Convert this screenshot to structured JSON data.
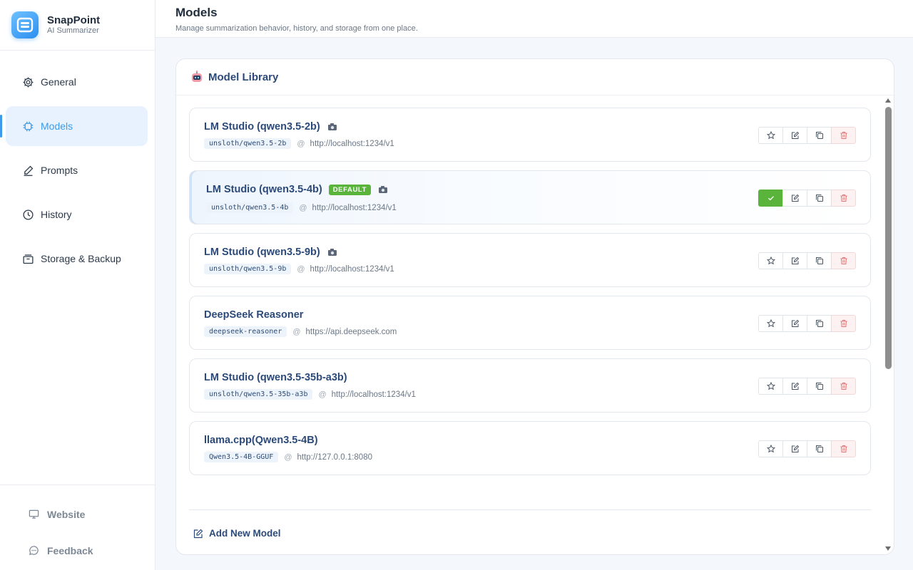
{
  "brand": {
    "name": "SnapPoint",
    "subtitle": "AI Summarizer"
  },
  "sidebar": {
    "items": [
      {
        "label": "General",
        "icon": "gear-icon",
        "active": false
      },
      {
        "label": "Models",
        "icon": "chip-icon",
        "active": true
      },
      {
        "label": "Prompts",
        "icon": "pen-icon",
        "active": false
      },
      {
        "label": "History",
        "icon": "clock-icon",
        "active": false
      },
      {
        "label": "Storage & Backup",
        "icon": "archive-icon",
        "active": false
      }
    ],
    "footer": [
      {
        "label": "Website",
        "icon": "monitor-icon"
      },
      {
        "label": "Feedback",
        "icon": "chat-bubble-icon"
      }
    ]
  },
  "header": {
    "title": "Models",
    "subtitle": "Manage summarization behavior, history, and storage from one place."
  },
  "panel": {
    "title": "Model Library",
    "icon": "robot-icon",
    "add_label": "Add New Model"
  },
  "models": [
    {
      "name": "LM Studio (qwen3.5-2b)",
      "model_id": "unsloth/qwen3.5-2b",
      "url": "http://localhost:1234/v1",
      "default": false,
      "vision": true
    },
    {
      "name": "LM Studio (qwen3.5-4b)",
      "model_id": "unsloth/qwen3.5-4b",
      "url": "http://localhost:1234/v1",
      "default": true,
      "badge": "DEFAULT",
      "vision": true
    },
    {
      "name": "LM Studio (qwen3.5-9b)",
      "model_id": "unsloth/qwen3.5-9b",
      "url": "http://localhost:1234/v1",
      "default": false,
      "vision": true
    },
    {
      "name": "DeepSeek Reasoner",
      "model_id": "deepseek-reasoner",
      "url": "https://api.deepseek.com",
      "default": false,
      "vision": false
    },
    {
      "name": "LM Studio (qwen3.5-35b-a3b)",
      "model_id": "unsloth/qwen3.5-35b-a3b",
      "url": "http://localhost:1234/v1",
      "default": false,
      "vision": false
    },
    {
      "name": "llama.cpp(Qwen3.5-4B)",
      "model_id": "Qwen3.5-4B-GGUF",
      "url": "http://127.0.0.1:8080",
      "default": false,
      "vision": false
    }
  ],
  "url_separator": "@",
  "colors": {
    "accent": "#3d9be9",
    "default_badge": "#5ab43c",
    "title": "#2b4a7a",
    "delete": "#e57373"
  }
}
